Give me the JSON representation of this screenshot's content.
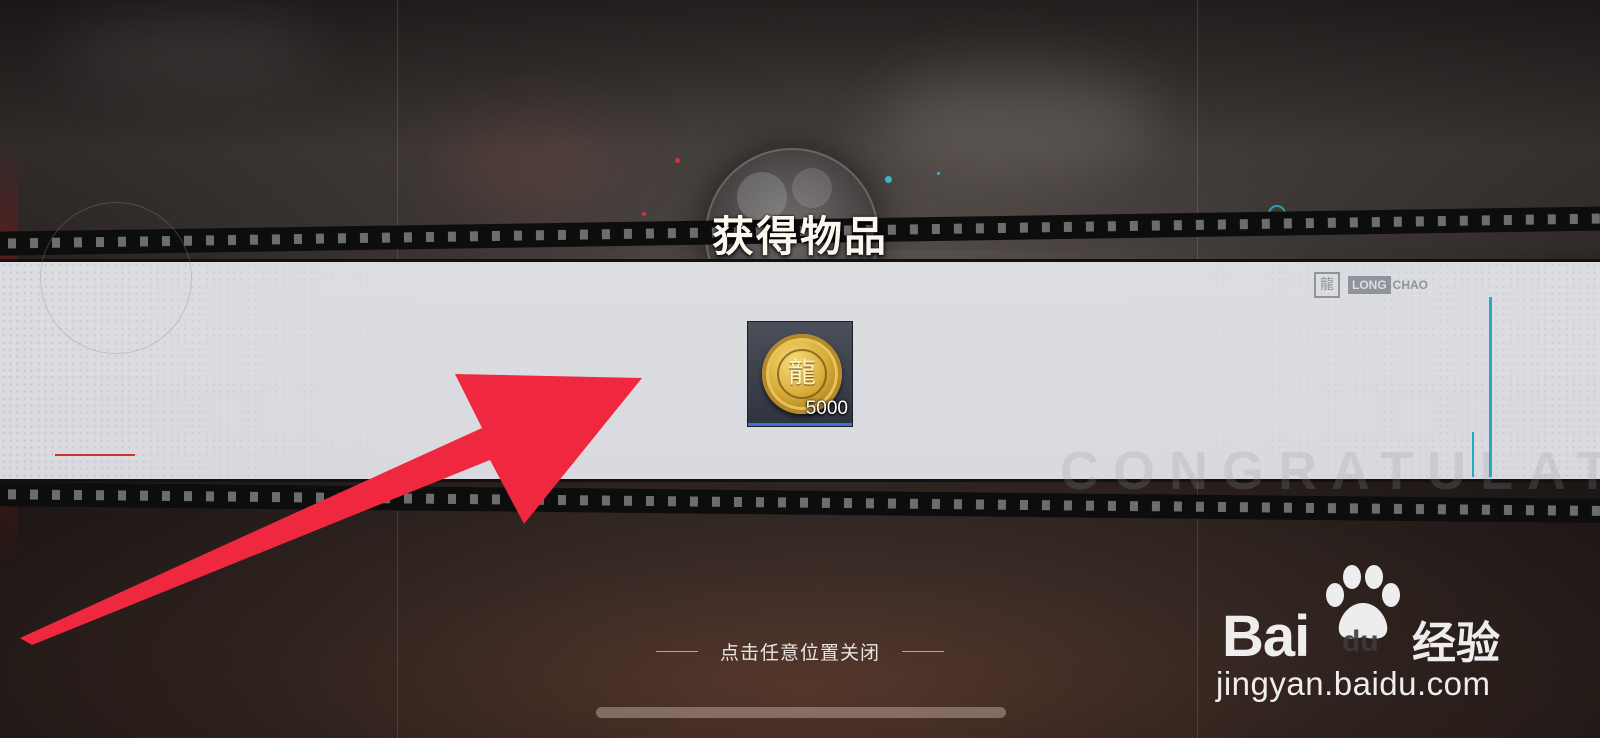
{
  "dialog": {
    "title": "获得物品",
    "brand_mark": "龍",
    "brand_long": "LONG",
    "brand_chao": "CHAO",
    "ghost_text": "CONGRATULATION",
    "close_hint": "点击任意位置关闭"
  },
  "items": [
    {
      "icon": "dragon-gold-coin-icon",
      "coin_glyph": "龍",
      "quantity": "5000"
    }
  ],
  "watermark": {
    "brand": "Bai",
    "du": "du",
    "product": "经验",
    "url": "jingyan.baidu.com"
  },
  "colors": {
    "title": "#fbf7ef",
    "banner": "#dcdde1",
    "accent_cyan": "#25a9bd",
    "arrow": "#f0283f",
    "rarity": "#3f6fd0"
  }
}
